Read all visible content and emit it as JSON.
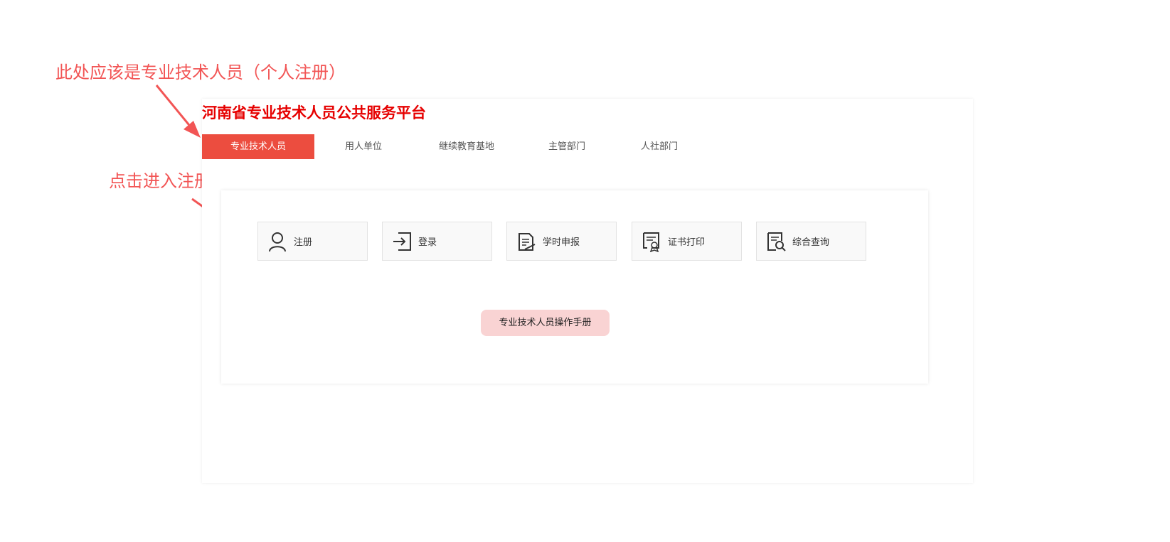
{
  "annotations": {
    "note_tab": "此处应该是专业技术人员（个人注册）",
    "note_register": "点击进入注册页面"
  },
  "platform": {
    "title": "河南省专业技术人员公共服务平台"
  },
  "tabs": [
    {
      "label": "专业技术人员",
      "active": true
    },
    {
      "label": "用人单位"
    },
    {
      "label": "继续教育基地"
    },
    {
      "label": "主管部门"
    },
    {
      "label": "人社部门"
    }
  ],
  "functions": [
    {
      "label": "注册",
      "icon": "user-icon"
    },
    {
      "label": "登录",
      "icon": "login-icon"
    },
    {
      "label": "学时申报",
      "icon": "document-edit-icon"
    },
    {
      "label": "证书打印",
      "icon": "certificate-icon"
    },
    {
      "label": "综合查询",
      "icon": "search-document-icon"
    }
  ],
  "manual_button": {
    "label": "专业技术人员操作手册"
  },
  "colors": {
    "accent_red": "#ec4d3f",
    "title_red": "#e60000",
    "annotation_red": "#f25555",
    "manual_bg": "#f9d3d3"
  }
}
